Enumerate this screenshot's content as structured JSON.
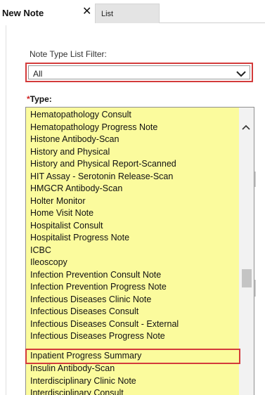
{
  "tabs": {
    "active_label": "New Note",
    "close_symbol": "✕",
    "inactive_label": "List"
  },
  "filter": {
    "label": "Note Type List Filter:",
    "value": "All",
    "chevron_icon": "chevron-down-icon"
  },
  "type_field": {
    "required_marker": "*",
    "label": "Type:"
  },
  "type_list": {
    "items": [
      "Hematopathology Consult",
      "Hematopathology Progress Note",
      "Histone Antibody-Scan",
      "History and Physical",
      "History and Physical Report-Scanned",
      "HIT Assay - Serotonin Release-Scan",
      "HMGCR Antibody-Scan",
      "Holter Monitor",
      "Home Visit Note",
      "Hospitalist Consult",
      "Hospitalist Progress Note",
      "ICBC",
      "Ileoscopy",
      "Infection Prevention Consult Note",
      "Infection Prevention Progress Note",
      "Infectious Diseases Clinic Note",
      "Infectious Diseases Consult",
      "Infectious Diseases Consult - External",
      "Infectious Diseases Progress Note",
      "Inpatient Progress Summary",
      "Insulin Antibody-Scan",
      "Interdisciplinary Clinic Note",
      "Interdisciplinary Consult"
    ],
    "highlighted_item": "Inpatient Progress Summary",
    "background_color": "#fbfb9d",
    "highlight_color": "#d33b3b"
  }
}
